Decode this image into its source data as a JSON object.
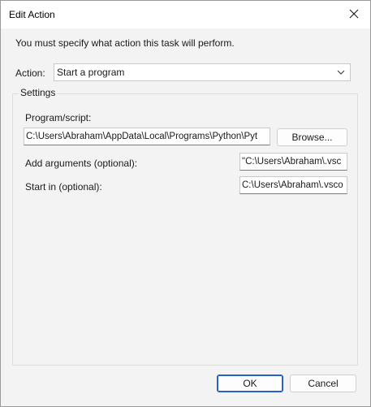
{
  "window": {
    "title": "Edit Action",
    "close_icon": "close-icon"
  },
  "prompt": "You must specify what action this task will perform.",
  "action": {
    "label": "Action:",
    "selected": "Start a program"
  },
  "settings": {
    "label": "Settings",
    "program": {
      "label": "Program/script:",
      "value": "C:\\Users\\Abraham\\AppData\\Local\\Programs\\Python\\Pyt",
      "browse_label": "Browse..."
    },
    "arguments": {
      "label": "Add arguments (optional):",
      "value": "\"C:\\Users\\Abraham\\.vsc"
    },
    "start_in": {
      "label": "Start in (optional):",
      "value": "C:\\Users\\Abraham\\.vsco"
    }
  },
  "buttons": {
    "ok": "OK",
    "cancel": "Cancel"
  },
  "colors": {
    "accent": "#2a5fc7",
    "background": "#f3f3f3"
  }
}
